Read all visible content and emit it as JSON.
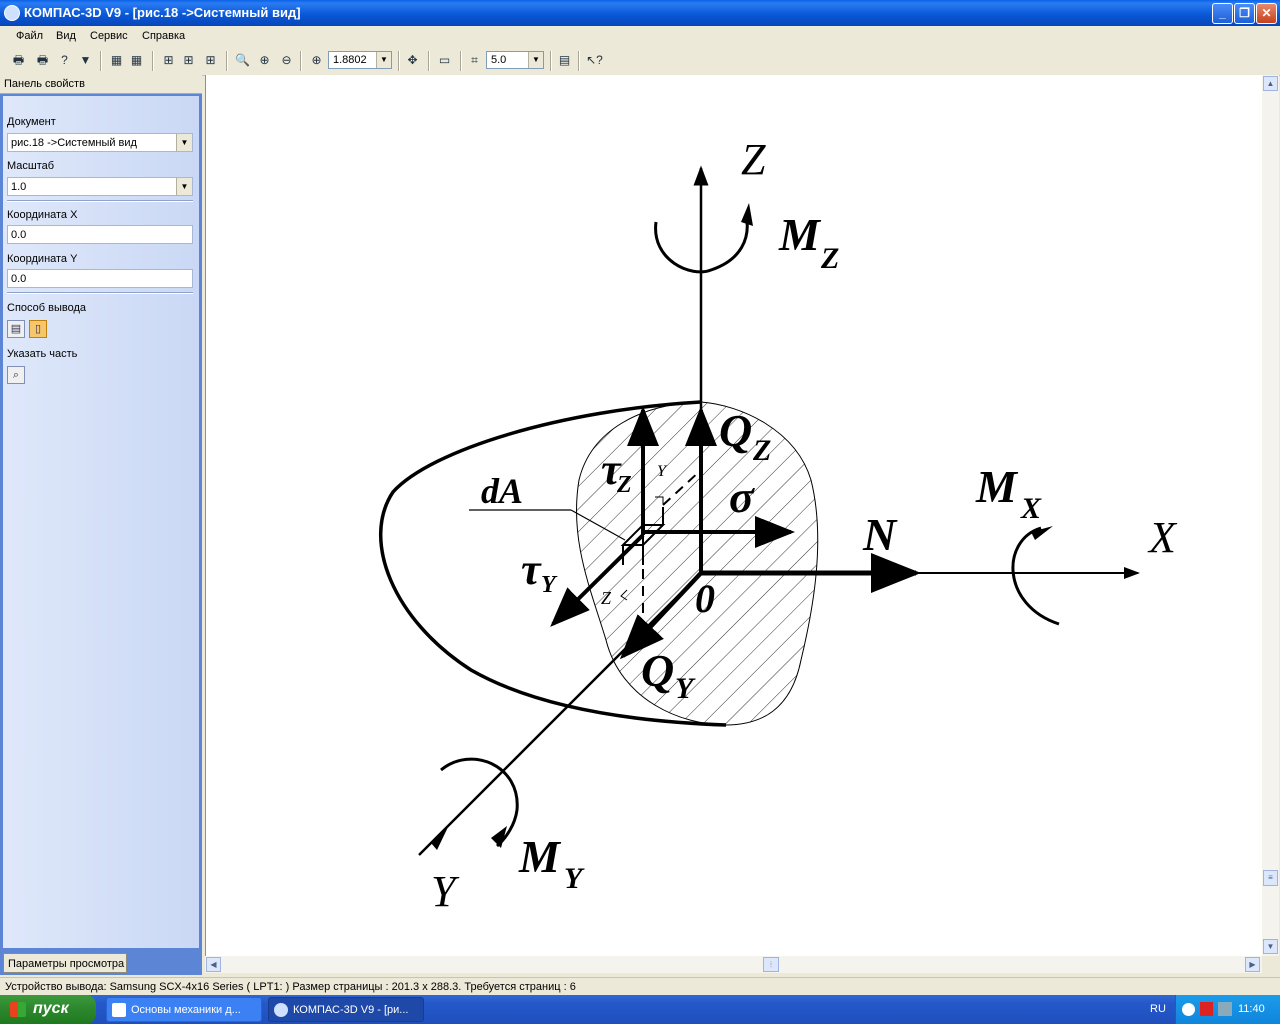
{
  "window": {
    "title": "КОМПАС-3D V9 - [рис.18 ->Системный вид]",
    "buttons": [
      "_",
      "❐",
      "✕"
    ]
  },
  "menu": [
    "Файл",
    "Вид",
    "Сервис",
    "Справка"
  ],
  "toolbar": {
    "zoom_value": "1.8802",
    "step_value": "5.0"
  },
  "panel": {
    "header": "Панель свойств",
    "document_label": "Документ",
    "document_value": "рис.18 ->Системный вид",
    "scale_label": "Масштаб",
    "scale_value": "1.0",
    "coord_x_label": "Координата X",
    "coord_x_value": "0.0",
    "coord_y_label": "Координата Y",
    "coord_y_value": "0.0",
    "output_label": "Способ вывода",
    "part_label": "Указать часть",
    "tab_label": "Параметры просмотра"
  },
  "drawing": {
    "labels": {
      "z_axis": "Z",
      "mz": "M",
      "mz_sub": "Z",
      "qz": "Q",
      "qz_sub": "Z",
      "tau_z": "τ",
      "tau_z_sub": "Z",
      "small_y": "Y",
      "da": "dA",
      "sigma": "σ",
      "n": "N",
      "mx": "M",
      "mx_sub": "X",
      "x_axis": "X",
      "tau_y": "τ",
      "tau_y_sub": "Y",
      "small_z": "Z",
      "origin": "0",
      "qy": "Q",
      "qy_sub": "Y",
      "my": "M",
      "my_sub": "Y",
      "y_axis": "Y"
    }
  },
  "statusbar": "Устройство вывода: Samsung SCX-4x16 Series ( LPT1: )  Размер страницы : 201.3 x 288.3.  Требуется страниц : 6",
  "taskbar": {
    "start": "пуск",
    "tasks": [
      "Основы механики д...",
      "КОМПАС-3D V9 - [ри..."
    ],
    "lang": "RU",
    "time": "11:40"
  }
}
